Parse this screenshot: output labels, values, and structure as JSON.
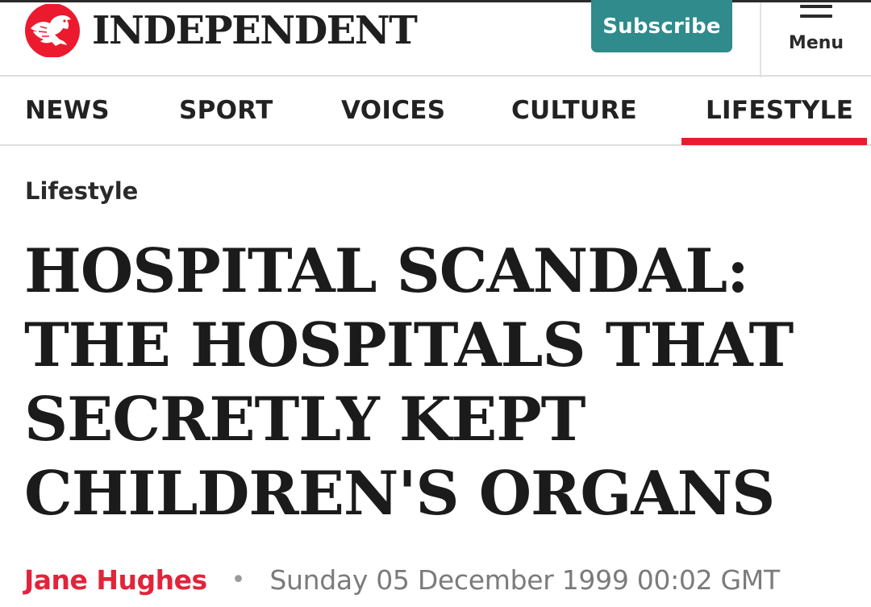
{
  "header": {
    "logo_text": "INDEPENDENT",
    "subscribe_label": "Subscribe",
    "menu_label": "Menu"
  },
  "nav": {
    "items": [
      {
        "label": "NEWS"
      },
      {
        "label": "SPORT"
      },
      {
        "label": "VOICES"
      },
      {
        "label": "CULTURE"
      },
      {
        "label": "LIFESTYLE",
        "active": true
      }
    ]
  },
  "article": {
    "section": "Lifestyle",
    "headline": "HOSPITAL SCANDAL: THE HOSPITALS THAT SECRETLY KEPT CHILDREN'S ORGANS",
    "author": "Jane Hughes",
    "separator": "•",
    "date": "Sunday 05 December 1999 00:02 GMT"
  },
  "colors": {
    "brand_red": "#ec1a2e",
    "subscribe_teal": "#2f8b8c",
    "author_red": "#e2243a",
    "text_dark": "#1b1b1b",
    "date_grey": "#7b7b7b"
  },
  "icons": {
    "logo": "eagle-logo-icon",
    "menu": "hamburger-menu-icon"
  }
}
